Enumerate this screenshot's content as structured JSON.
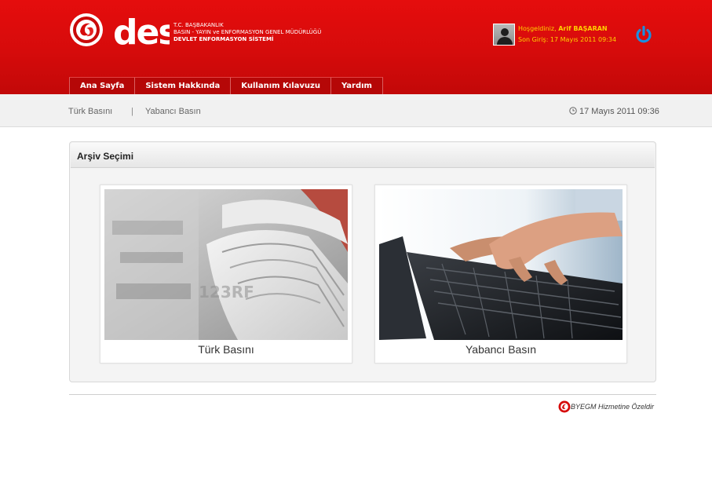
{
  "header": {
    "logo_des": "des",
    "logo_line1": "T.C. BAŞBAKANLIK",
    "logo_line2": "BASIN - YAYIN ve ENFORMASYON GENEL MÜDÜRLÜĞÜ",
    "logo_line3": "DEVLET ENFORMASYON SİSTEMİ",
    "welcome_prefix": "Hoşgeldiniz, ",
    "user_name": "Arif BAŞARAN",
    "last_login": "Son Giriş: 17 Mayıs 2011 09:34",
    "icons": {
      "avatar": "user-avatar-icon",
      "logout": "power-icon",
      "emblem": "byegm-emblem-icon"
    },
    "colors": {
      "brand_red": "#d60b0b",
      "welcome_yellow": "#ffd200",
      "power_blue": "#1a8fe0"
    }
  },
  "nav": {
    "items": [
      {
        "label": "Ana Sayfa"
      },
      {
        "label": "Sistem Hakkında"
      },
      {
        "label": "Kullanım Kılavuzu"
      },
      {
        "label": "Yardım"
      }
    ]
  },
  "subbar": {
    "crumb_a": "Türk Basını",
    "separator": "|",
    "crumb_b": "Yabancı Basın",
    "datetime": "17 Mayıs 2011 09:36"
  },
  "panel": {
    "title": "Arşiv Seçimi",
    "cards": [
      {
        "label": "Türk Basını",
        "image": "newspapers-photo",
        "watermark": "123RF"
      },
      {
        "label": "Yabancı Basın",
        "image": "laptop-typing-photo"
      }
    ]
  },
  "footer": {
    "text": "BYEGM Hizmetine Özeldir"
  }
}
